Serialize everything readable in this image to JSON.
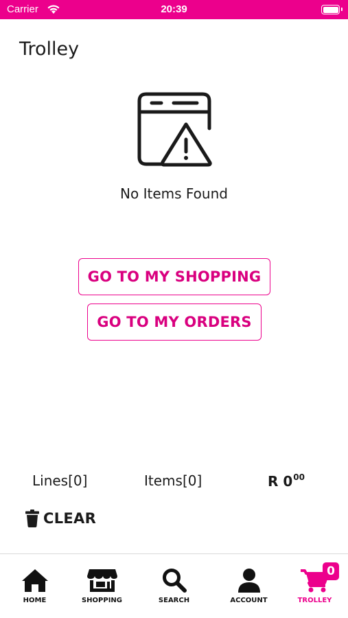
{
  "status_bar": {
    "carrier": "Carrier",
    "time": "20:39",
    "wifi_icon": "wifi-icon",
    "battery_icon": "battery-icon"
  },
  "page": {
    "title": "Trolley"
  },
  "empty_state": {
    "icon": "browser-warning-icon",
    "message": "No Items Found"
  },
  "actions": {
    "go_shopping": "GO TO MY SHOPPING",
    "go_orders": "GO TO MY ORDERS"
  },
  "summary": {
    "lines": "Lines[0]",
    "items": "Items[0]",
    "total_main": "R 0",
    "total_cents": "00"
  },
  "clear": {
    "icon": "trash-icon",
    "label": "CLEAR"
  },
  "tab_bar": {
    "active": "trolley",
    "accent_color": "#ec008c",
    "tabs": [
      {
        "label": "HOME",
        "icon": "home-icon"
      },
      {
        "label": "SHOPPING",
        "icon": "store-icon"
      },
      {
        "label": "SEARCH",
        "icon": "search-icon"
      },
      {
        "label": "ACCOUNT",
        "icon": "person-icon"
      },
      {
        "label": "TROLLEY",
        "icon": "cart-icon"
      }
    ],
    "trolley_badge": "0"
  },
  "colors": {
    "brand": "#ec008c",
    "text": "#1a1a1a",
    "background": "#ffffff"
  }
}
